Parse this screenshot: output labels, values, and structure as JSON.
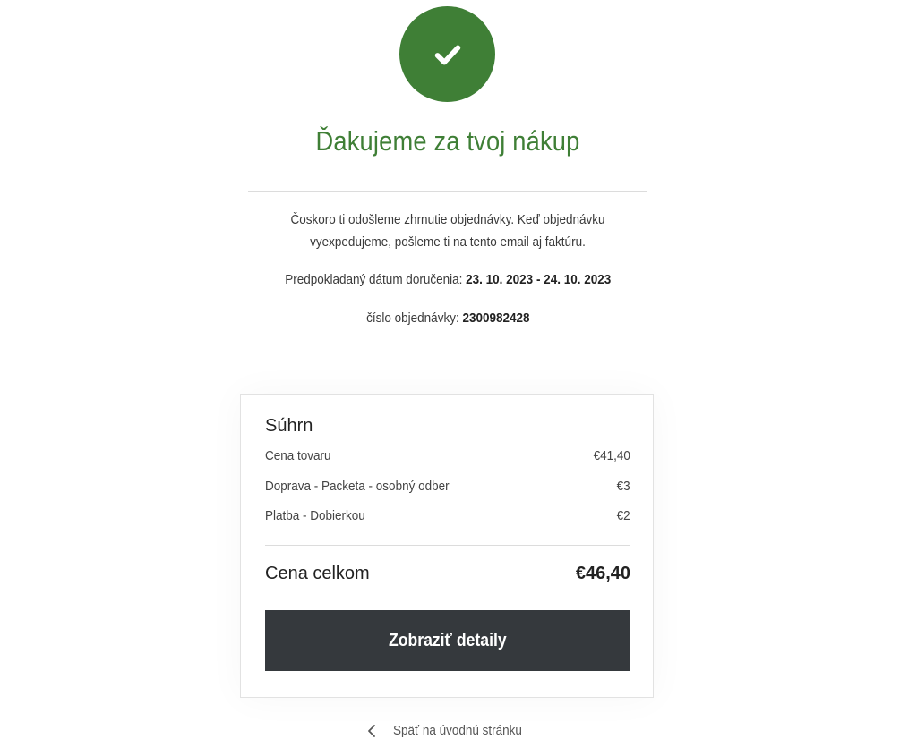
{
  "confirmation": {
    "icon": "checkmark-icon",
    "accent_color": "#3f7f36",
    "title": "Ďakujeme za tvoj nákup",
    "message": "Čoskoro ti odošleme zhrnutie objednávky. Keď objednávku vyexpedujeme, pošleme ti na tento email aj faktúru.",
    "delivery_label": "Predpokladaný dátum doručenia:",
    "delivery_value": "23. 10. 2023 - 24. 10. 2023",
    "order_label": "číslo objednávky:",
    "order_value": "2300982428"
  },
  "summary": {
    "title": "Súhrn",
    "items": [
      {
        "label": "Cena tovaru",
        "value": "€41,40"
      },
      {
        "label": "Doprava - Packeta - osobný odber",
        "value": "€3"
      },
      {
        "label": "Platba - Dobierkou",
        "value": "€2"
      }
    ],
    "total_label": "Cena celkom",
    "total_value": "€46,40",
    "button_label": "Zobraziť detaily",
    "button_color": "#35393d"
  },
  "footer": {
    "back_icon": "chevron-left-icon",
    "back_label": "Späť na úvodnú stránku"
  }
}
